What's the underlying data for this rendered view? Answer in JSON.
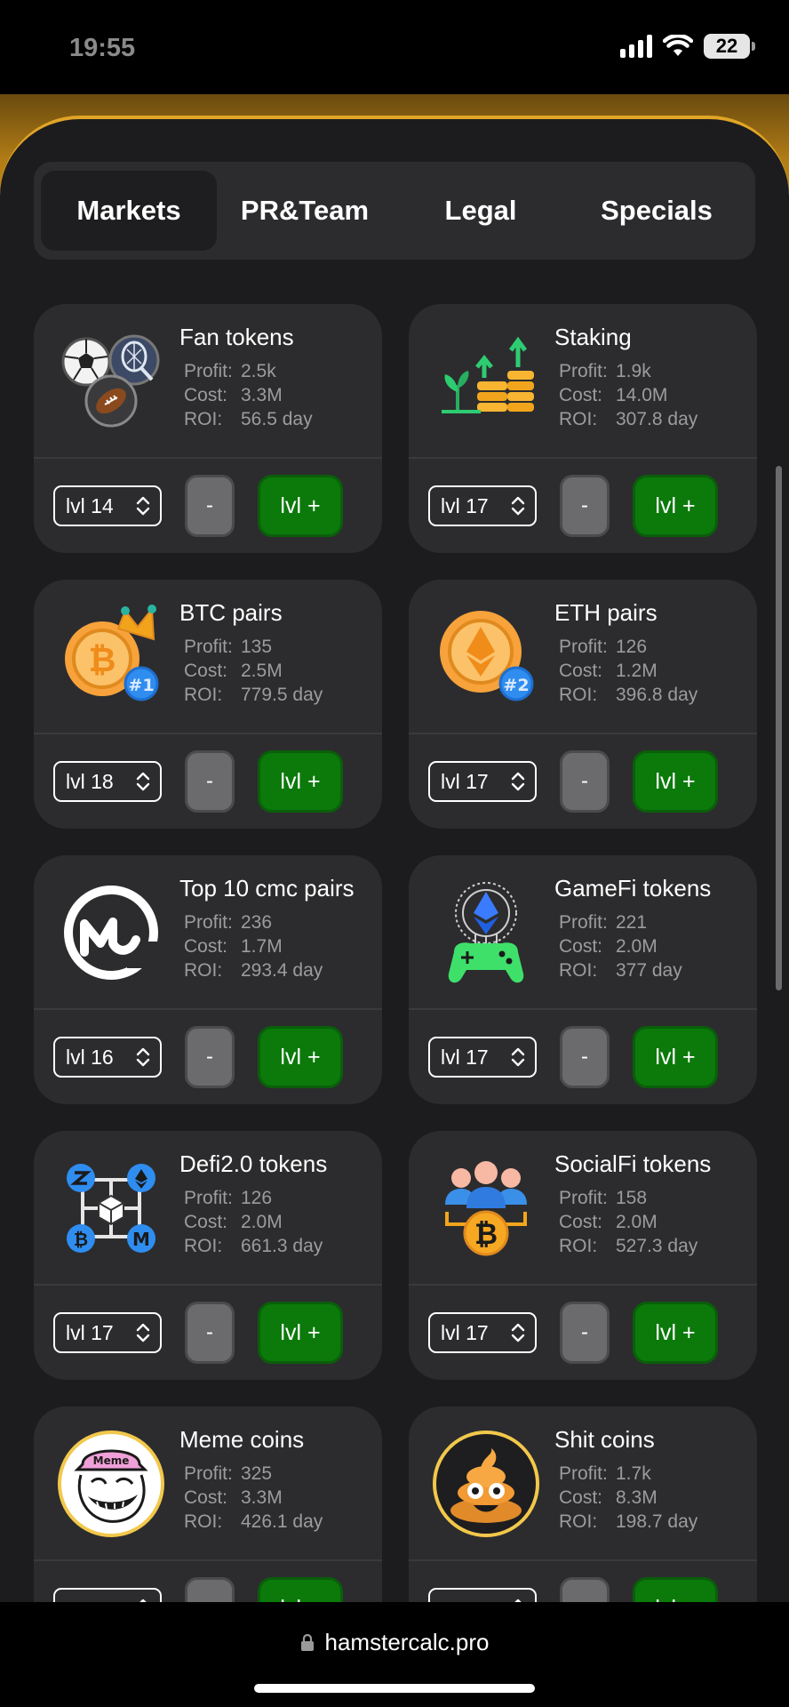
{
  "status_bar": {
    "time": "19:55",
    "battery": "22"
  },
  "tabs": [
    {
      "label": "Markets",
      "active": true
    },
    {
      "label": "PR&Team",
      "active": false
    },
    {
      "label": "Legal",
      "active": false
    },
    {
      "label": "Specials",
      "active": false
    }
  ],
  "labels": {
    "profit": "Profit:",
    "cost": "Cost:",
    "roi": "ROI:",
    "minus": "-",
    "plus": "lvl +"
  },
  "cards": [
    {
      "title": "Fan tokens",
      "profit": "2.5k",
      "cost": "3.3M",
      "roi": "56.5 day",
      "level": "lvl 14",
      "icon": "sports-balls-icon"
    },
    {
      "title": "Staking",
      "profit": "1.9k",
      "cost": "14.0M",
      "roi": "307.8 day",
      "level": "lvl 17",
      "icon": "staking-growth-icon"
    },
    {
      "title": "BTC pairs",
      "profit": "135",
      "cost": "2.5M",
      "roi": "779.5 day",
      "level": "lvl 18",
      "icon": "btc-coin-icon"
    },
    {
      "title": "ETH pairs",
      "profit": "126",
      "cost": "1.2M",
      "roi": "396.8 day",
      "level": "lvl 17",
      "icon": "eth-coin-icon"
    },
    {
      "title": "Top 10 cmc pairs",
      "profit": "236",
      "cost": "1.7M",
      "roi": "293.4 day",
      "level": "lvl 16",
      "icon": "coinmarketcap-icon"
    },
    {
      "title": "GameFi tokens",
      "profit": "221",
      "cost": "2.0M",
      "roi": "377 day",
      "level": "lvl 17",
      "icon": "gamepad-eth-icon"
    },
    {
      "title": "Defi2.0 tokens",
      "profit": "126",
      "cost": "2.0M",
      "roi": "661.3 day",
      "level": "lvl 17",
      "icon": "defi-network-icon"
    },
    {
      "title": "SocialFi tokens",
      "profit": "158",
      "cost": "2.0M",
      "roi": "527.3 day",
      "level": "lvl 17",
      "icon": "social-btc-icon"
    },
    {
      "title": "Meme coins",
      "profit": "325",
      "cost": "3.3M",
      "roi": "426.1 day",
      "level": "",
      "icon": "troll-face-meme-icon"
    },
    {
      "title": "Shit coins",
      "profit": "1.7k",
      "cost": "8.3M",
      "roi": "198.7 day",
      "level": "",
      "icon": "poop-emoji-icon"
    }
  ],
  "browser": {
    "url": "hamstercalc.pro"
  },
  "colors": {
    "accent_gold": "#e0a526",
    "button_green": "#0b7a0b",
    "card_bg": "#2c2c2e"
  },
  "icon_text": {
    "btc_badge": "#1",
    "eth_badge": "#2",
    "meme_hat": "Meme"
  }
}
